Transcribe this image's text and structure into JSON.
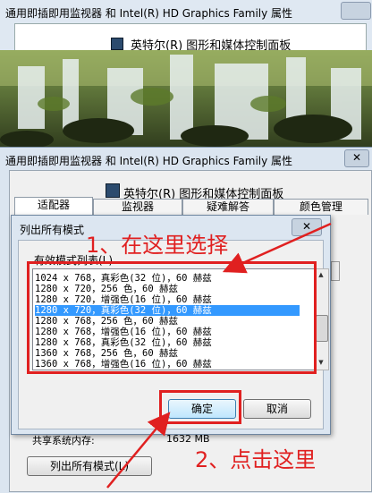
{
  "back_window": {
    "title": "通用即插即用监视器 和 Intel(R) HD Graphics Family 属性",
    "banner": "英特尔(R) 图形和媒体控制面板"
  },
  "dialog": {
    "title": "通用即插即用监视器 和 Intel(R) HD Graphics Family 属性",
    "close_label": "✕",
    "subtitle": "英特尔(R) 图形和媒体控制面板",
    "tabs": [
      "适配器",
      "监视器",
      "疑难解答",
      "颜色管理"
    ],
    "memory_label": "共享系统内存:",
    "memory_value": "1632 MB",
    "list_all_modes_button": "列出所有模式(L)"
  },
  "popup": {
    "title": "列出所有模式",
    "close_label": "✕",
    "group_label": "有效模式列表(L)",
    "modes": [
      "1024 x 768，真彩色(32 位)，60 赫兹",
      "1280 x 720，256 色，60 赫兹",
      "1280 x 720，增强色(16 位)，60 赫兹",
      "1280 x 720，真彩色(32 位)，60 赫兹",
      "1280 x 768，256 色，60 赫兹",
      "1280 x 768，增强色(16 位)，60 赫兹",
      "1280 x 768，真彩色(32 位)，60 赫兹",
      "1360 x 768，256 色，60 赫兹",
      "1360 x 768，增强色(16 位)，60 赫兹"
    ],
    "selected_index": 3,
    "ok_button": "确定",
    "cancel_button": "取消"
  },
  "annotations": {
    "step1": "1、在这里选择",
    "step2": "2、点击这里",
    "color": "#e02020"
  }
}
